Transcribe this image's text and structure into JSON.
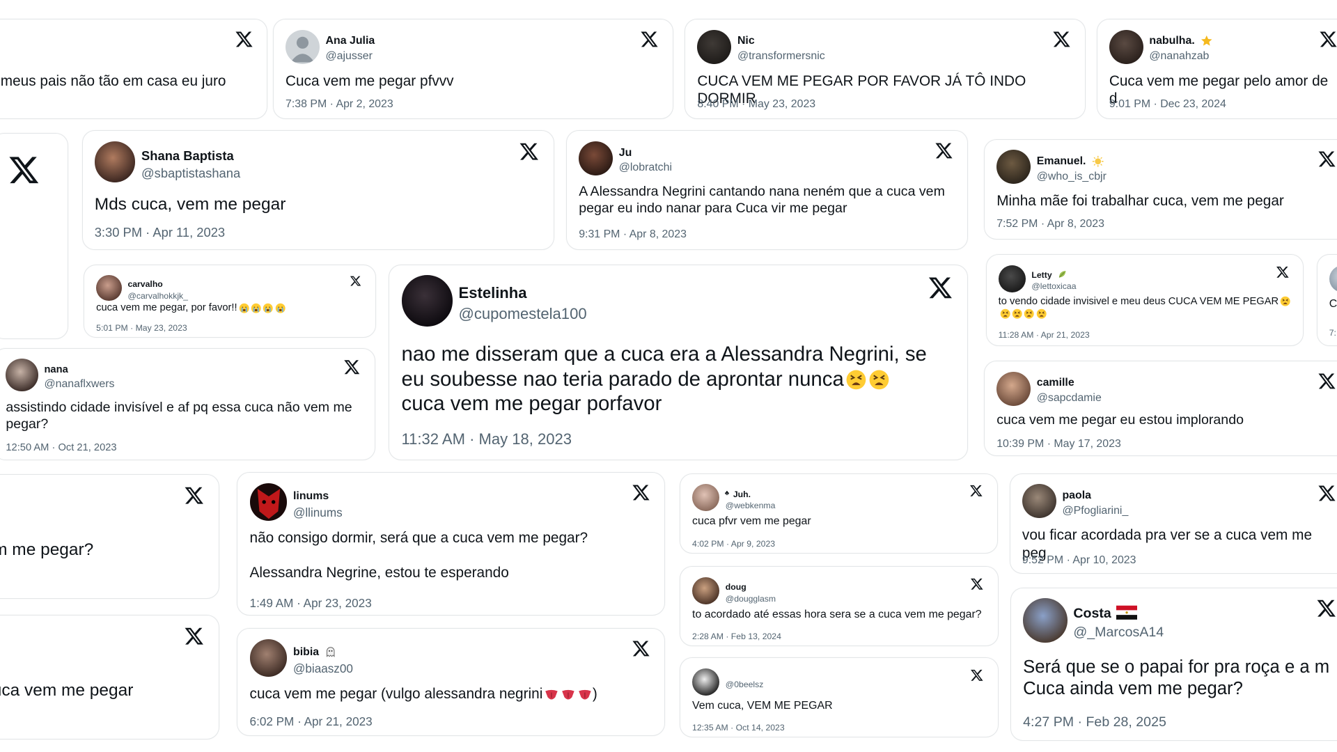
{
  "tweets": [
    {
      "id": "t0",
      "name": "",
      "handle": "",
      "text": "ar meus pais não tão em casa eu juro",
      "time": "",
      "avatar": "none"
    },
    {
      "id": "t1",
      "name": "Ana Julia",
      "handle": "@ajusser",
      "text": "Cuca vem me pegar pfvvv",
      "time": "7:38 PM · Apr 2, 2023",
      "avatar": "default"
    },
    {
      "id": "t2",
      "name": "Nic",
      "handle": "@transformersnic",
      "text": "CUCA VEM ME PEGAR POR FAVOR JÁ TÔ INDO DORMIR",
      "time": "8:40 PM · May 23, 2023",
      "avatar": "photo"
    },
    {
      "id": "t3",
      "name": "nabulha.",
      "handle": "@nanahzab",
      "text": "Cuca vem me pegar pelo amor de d",
      "time": "9:01 PM · Dec 23, 2024",
      "avatar": "photo",
      "badge": "star"
    },
    {
      "id": "t4",
      "name": "Shana Baptista",
      "handle": "@sbaptistashana",
      "text": "Mds cuca, vem me pegar",
      "time": "3:30 PM · Apr 11, 2023",
      "avatar": "photo"
    },
    {
      "id": "t5",
      "name": "Ju",
      "handle": "@lobratchi",
      "text": "A Alessandra Negrini cantando nana neném que a cuca vem pegar eu indo nanar para Cuca vir me pegar",
      "time": "9:31 PM · Apr 8, 2023",
      "avatar": "photo"
    },
    {
      "id": "t6",
      "name": "Emanuel.",
      "handle": "@who_is_cbjr",
      "text": "Minha mãe foi trabalhar cuca, vem me pegar",
      "time": "7:52 PM · Apr 8, 2023",
      "avatar": "photo",
      "badge": "sun"
    },
    {
      "id": "t7",
      "name": "carvalho",
      "handle": "@carvalhokkjk_",
      "text": "cuca vem me pegar, por favor!!",
      "time": "5:01 PM · May 23, 2023",
      "avatar": "photo",
      "emoji": [
        "sob",
        "sob",
        "sob",
        "sob"
      ]
    },
    {
      "id": "t8",
      "name": "Estelinha",
      "handle": "@cupomestela100",
      "text": "nao me disseram que a cuca era a Alessandra Negrini, se eu soubesse nao teria parado de aprontar nunca",
      "text2": "cuca vem me pegar porfavor",
      "time": "11:32 AM · May 18, 2023",
      "avatar": "photo",
      "emoji": [
        "tired",
        "tired"
      ]
    },
    {
      "id": "t9",
      "name": "Letty",
      "handle": "@lettoxicaa",
      "text": "to vendo cidade invisivel e meu deus CUCA VEM ME PEGAR",
      "time": "11:28 AM · Apr 21, 2023",
      "avatar": "photo",
      "badge": "leaf",
      "emoji": [
        "tired",
        "tired",
        "tired",
        "tired",
        "tired"
      ]
    },
    {
      "id": "t10",
      "name": "nana",
      "handle": "@nanaflxwers",
      "text": "assistindo cidade invisível e af pq essa cuca não vem me pegar?",
      "time": "12:50 AM · Oct 21, 2023",
      "avatar": "photo"
    },
    {
      "id": "t11",
      "name": "camille",
      "handle": "@sapcdamie",
      "text": "cuca vem me pegar eu estou implorando",
      "time": "10:39 PM · May 17, 2023",
      "avatar": "photo"
    },
    {
      "id": "t12",
      "name": "",
      "handle": "",
      "text": "em me pegar?",
      "time": "",
      "avatar": "none"
    },
    {
      "id": "t13",
      "name": "linums",
      "handle": "@llinums",
      "text": "não consigo dormir, será que a cuca vem me pegar?",
      "text2": "Alessandra Negrine, estou te esperando",
      "time": "1:49 AM · Apr 23, 2023",
      "avatar": "red"
    },
    {
      "id": "t14",
      "name": "Juh.",
      "handle": "@webkenma",
      "text": "cuca pfvr vem me pegar",
      "time": "4:02 PM · Apr 9, 2023",
      "avatar": "photo",
      "prefix": "♣"
    },
    {
      "id": "t15",
      "name": "paola",
      "handle": "@Pfogliarini_",
      "text": "vou ficar acordada pra ver se a cuca vem me peg",
      "time": "9:52 PM · Apr 10, 2023",
      "avatar": "photo"
    },
    {
      "id": "t16",
      "name": "doug",
      "handle": "@dougglasm",
      "text": "to acordado até essas hora sera se a cuca vem me pegar?",
      "time": "2:28 AM · Feb 13, 2024",
      "avatar": "photo"
    },
    {
      "id": "t17",
      "name": "",
      "handle": "",
      "text": "cuca vem me pegar",
      "time": "",
      "avatar": "none"
    },
    {
      "id": "t18",
      "name": "bibia",
      "handle": "@biaasz00",
      "text": "cuca vem me pegar (vulgo alessandra negrini",
      "text_end": ")",
      "time": "6:02 PM · Apr 21, 2023",
      "avatar": "photo",
      "badge": "ghost",
      "emoji": [
        "tongue",
        "tongue",
        "tongue"
      ]
    },
    {
      "id": "t19",
      "name": "",
      "handle": "@0beelsz",
      "text": "Vem cuca, VEM ME PEGAR",
      "time": "12:35 AM · Oct 14, 2023",
      "avatar": "photo"
    },
    {
      "id": "t20",
      "name": "Costa",
      "handle": "@_MarcosA14",
      "text": "Será que se o papai for pra roça e a m",
      "text2": "Cuca ainda vem me pegar?",
      "time": "4:27 PM · Feb 28, 2025",
      "avatar": "photo",
      "badge": "flag"
    },
    {
      "id": "t21",
      "name": "",
      "handle": "",
      "text": "C",
      "time": "7:",
      "avatar": "photo"
    }
  ],
  "icons": {
    "x_logo": "x-logo-icon"
  }
}
